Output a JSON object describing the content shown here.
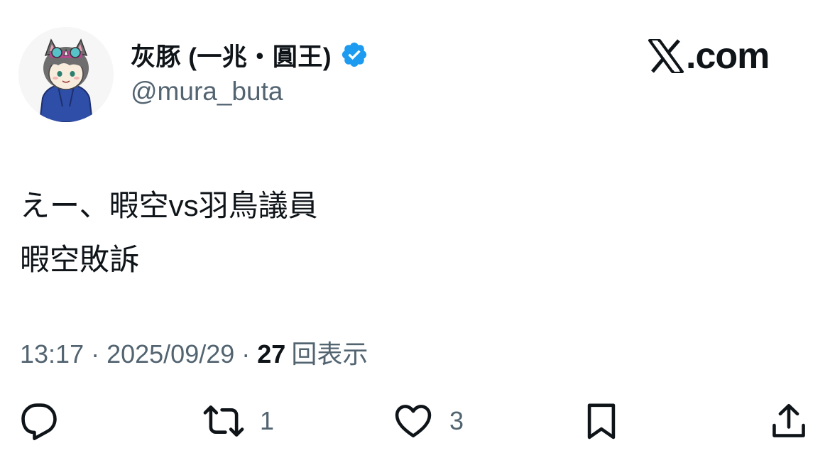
{
  "author": {
    "display_name": "灰豚 (一兆・圓王)",
    "handle": "@mura_buta",
    "verified": true
  },
  "brand": {
    "text": ".com",
    "logo_icon": "x-logo-icon"
  },
  "tweet": {
    "lines": [
      "えー、暇空vs羽鳥議員",
      "暇空敗訴"
    ]
  },
  "meta": {
    "time": "13:17",
    "separator": "·",
    "date": "2025/09/29",
    "views_count": "27",
    "views_label": "回表示"
  },
  "actions": {
    "reply": {
      "icon": "reply-icon",
      "count": ""
    },
    "retweet": {
      "icon": "retweet-icon",
      "count": "1"
    },
    "like": {
      "icon": "heart-icon",
      "count": "3"
    },
    "bookmark": {
      "icon": "bookmark-icon",
      "count": ""
    },
    "share": {
      "icon": "share-icon",
      "count": ""
    }
  },
  "colors": {
    "text_primary": "#0f1419",
    "text_secondary": "#536471",
    "verified_blue": "#1d9bf0",
    "background": "#ffffff"
  }
}
